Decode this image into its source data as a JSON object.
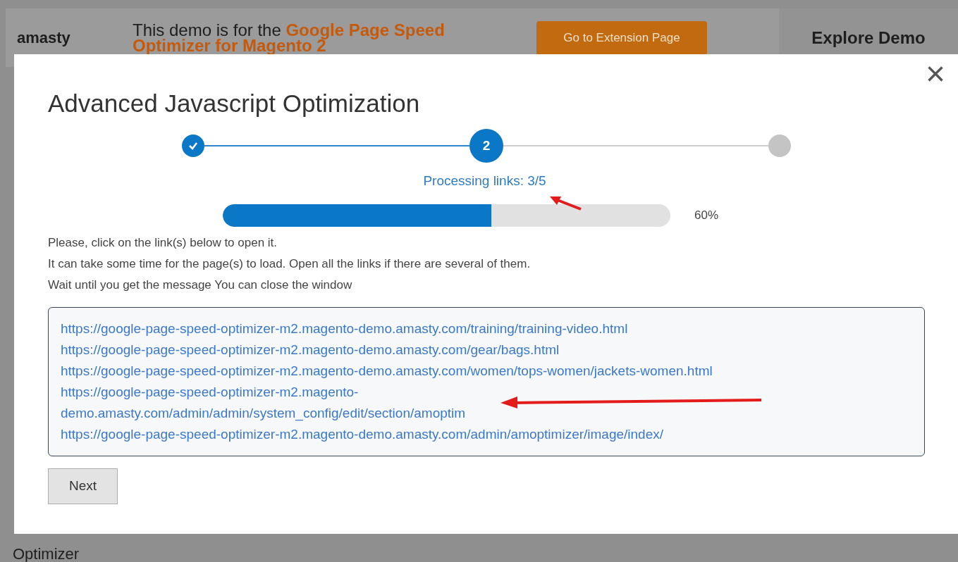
{
  "header": {
    "logo": "amasty",
    "banner_prefix": "This demo is for the ",
    "banner_highlight": "Google Page Speed Optimizer for Magento 2",
    "extension_button": "Go to Extension Page",
    "explore": "Explore Demo"
  },
  "background_text": "Optimizer",
  "modal": {
    "title": "Advanced Javascript Optimization",
    "close": "×",
    "steps": [
      {
        "done": true,
        "selected": false
      },
      {
        "label": "2",
        "done": false,
        "selected": true
      },
      {
        "done": false,
        "selected": false
      }
    ],
    "status": "Processing links: 3/5",
    "progress": {
      "level": 0.6,
      "reading": "60%"
    },
    "instructions": [
      "Please, click on the link(s) below to open it.",
      "It can take some time for the page(s) to load. Open all the links if there are several of them.",
      "Wait until you get the message You can close the window"
    ],
    "links": [
      "https://google-page-speed-optimizer-m2.magento-demo.amasty.com/training/training-video.html",
      "https://google-page-speed-optimizer-m2.magento-demo.amasty.com/gear/bags.html",
      "https://google-page-speed-optimizer-m2.magento-demo.amasty.com/women/tops-women/jackets-women.html",
      "https://google-page-speed-optimizer-m2.magento-demo.amasty.com/admin/admin/system_config/edit/section/amoptim",
      "https://google-page-speed-optimizer-m2.magento-demo.amasty.com/admin/amoptimizer/image/index/"
    ],
    "next_button": "Next"
  }
}
